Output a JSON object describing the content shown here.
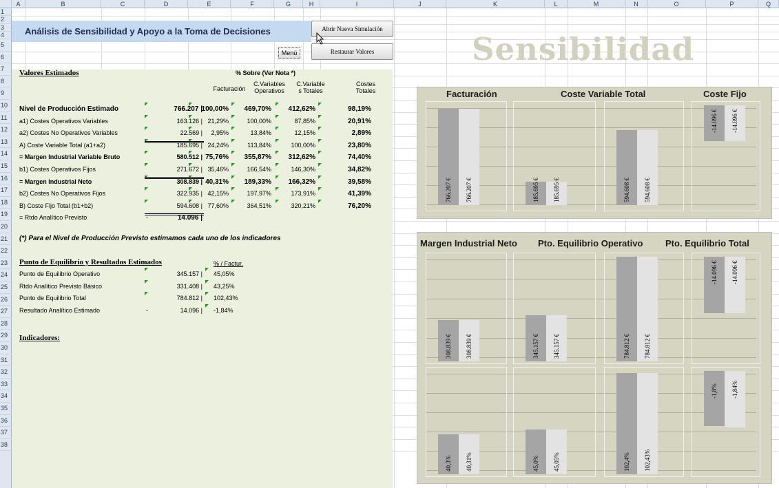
{
  "columns": [
    "A",
    "B",
    "C",
    "D",
    "E",
    "F",
    "G",
    "H",
    "I",
    "J",
    "K",
    "L",
    "M",
    "N",
    "O",
    "P",
    "Q"
  ],
  "rows": [
    "1",
    "2",
    "3",
    "4",
    "5",
    "6",
    "7",
    "8",
    "9",
    "10",
    "11",
    "12",
    "13",
    "14",
    "15",
    "16",
    "17",
    "18",
    "19",
    "20",
    "21",
    "22",
    "23",
    "24",
    "25",
    "26",
    "27",
    "28",
    "29",
    "30",
    "31",
    "32",
    "33",
    "34",
    "35",
    "36",
    "37",
    "38"
  ],
  "title": "Análisis de Sensibilidad y Apoyo a la Toma de Decisiones",
  "buttons": {
    "new_sim": "Abrir Nueva Simulación",
    "menu": "Menú",
    "restore": "Restaurar Valores"
  },
  "banner": "Sensibilidad",
  "section1": {
    "heading": "Valores Estimados",
    "pct_header": "% Sobre (Ver Nota *)",
    "col_headers": [
      [
        "Facturación",
        ""
      ],
      [
        "C.Variables",
        "Operativos"
      ],
      [
        "C.Variable",
        "s Totales"
      ],
      [
        "Costes",
        "Totales"
      ]
    ]
  },
  "table": [
    {
      "label": "Nivel de Producción Estimado",
      "value": "766.207 |",
      "c1": "100,00%",
      "c2": "469,70%",
      "c3": "412,62%",
      "c4": "98,19%",
      "bold": true
    },
    {
      "label": "a1) Costes Operativos Variables",
      "value": "163.126 |",
      "c1": "21,29%",
      "c2": "100,00%",
      "c3": "87,85%",
      "c4": "20,91%"
    },
    {
      "label": "a2) Costes No Operativos Variables",
      "value": "22.569 |",
      "c1": "2,95%",
      "c2": "13,84%",
      "c3": "12,15%",
      "c4": "2,89%"
    },
    {
      "label": "A) Coste Variable Total (a1+a2)",
      "value": "185.695 |",
      "c1": "24,24%",
      "c2": "113,84%",
      "c3": "100,00%",
      "c4": "23,80%"
    },
    {
      "label": "= Margen Industrial Variable Bruto",
      "value": "580.512 |",
      "c1": "75,76%",
      "c2": "355,87%",
      "c3": "312,62%",
      "c4": "74,40%",
      "bold": true
    },
    {
      "label": "b1) Costes Operativos Fijos",
      "value": "271.672 |",
      "c1": "35,46%",
      "c2": "166,54%",
      "c3": "146,30%",
      "c4": "34,82%"
    },
    {
      "label": "= Margen Industrial Neto",
      "value": "308.839 |",
      "c1": "40,31%",
      "c2": "189,33%",
      "c3": "166,32%",
      "c4": "39,58%",
      "bold": true
    },
    {
      "label": "b2) Costes No Operativos Fijos",
      "value": "322.935 |",
      "c1": "42,15%",
      "c2": "197,97%",
      "c3": "173,91%",
      "c4": "41,39%"
    },
    {
      "label": "B) Coste Fijo Total (b1+b2)",
      "value": "594.608 |",
      "c1": "77,60%",
      "c2": "364,51%",
      "c3": "320,21%",
      "c4": "76,20%"
    },
    {
      "label": "= Rtdo Analítico Previsto",
      "value": "14.096 |",
      "dash": "-"
    }
  ],
  "note": "(*) Para el Nivel de Producción Previsto estimamos cada uno de los indicadores",
  "section2": {
    "heading": "Punto de Equilibrio y Resultados Estimados",
    "pct_header": "% / Factur."
  },
  "table2": [
    {
      "label": "Punto de Equilibrio Operativo",
      "value": "345.157 |",
      "pct": "45,05%"
    },
    {
      "label": "Rtdo Analítico Previsto Básico",
      "value": "331.408 |",
      "pct": "43,25%"
    },
    {
      "label": "Punto de Equilibrio Total",
      "value": "784.812 |",
      "pct": "102,43%"
    },
    {
      "label": "Resultado Analítico Estimado",
      "value": "14.096 |",
      "pct": "-1,84%",
      "dash": "-"
    }
  ],
  "section3": {
    "heading": "Indicadores:"
  },
  "chart_data": [
    {
      "type": "bar",
      "titles": [
        "Facturación",
        "Coste Variable  Total",
        "Coste Fijo"
      ],
      "groups": [
        {
          "values": [
            766207,
            766207
          ],
          "labels": [
            "766.207 €",
            "766.207 €"
          ]
        },
        {
          "values": [
            185695,
            185695
          ],
          "labels": [
            "185.695 €",
            "185.695 €"
          ]
        },
        {
          "values": [
            594608,
            594608
          ],
          "labels": [
            "594.608 €",
            "594.608 €"
          ]
        },
        {
          "values": [
            -14096,
            -14096
          ],
          "labels": [
            "-14.096 €",
            "-14.096 €"
          ]
        }
      ]
    },
    {
      "type": "bar",
      "titles": [
        "Margen Industrial Neto",
        "Pto. Equilibrio Operativo",
        "Pto. Equilibrio Total"
      ],
      "groups": [
        {
          "values": [
            308839,
            308839
          ],
          "labels": [
            "308.839 €",
            "308.839 €"
          ]
        },
        {
          "values": [
            345157,
            345157
          ],
          "labels": [
            "345.157 €",
            "345.157 €"
          ]
        },
        {
          "values": [
            784812,
            784812
          ],
          "labels": [
            "784.812 €",
            "784.812 €"
          ]
        },
        {
          "values": [
            -14096,
            -14096
          ],
          "labels": [
            "-14.096 €",
            "-14.096 €"
          ]
        }
      ]
    },
    {
      "type": "bar",
      "titles": [],
      "groups": [
        {
          "values": [
            40.3,
            40.31
          ],
          "labels": [
            "40,3%",
            "40,31%"
          ]
        },
        {
          "values": [
            45.0,
            45.05
          ],
          "labels": [
            "45,0%",
            "45,05%"
          ]
        },
        {
          "values": [
            102.4,
            102.43
          ],
          "labels": [
            "102,4%",
            "102,43%"
          ]
        },
        {
          "values": [
            -1.8,
            -1.84
          ],
          "labels": [
            "-1,8%",
            "-1,84%"
          ]
        }
      ]
    }
  ]
}
